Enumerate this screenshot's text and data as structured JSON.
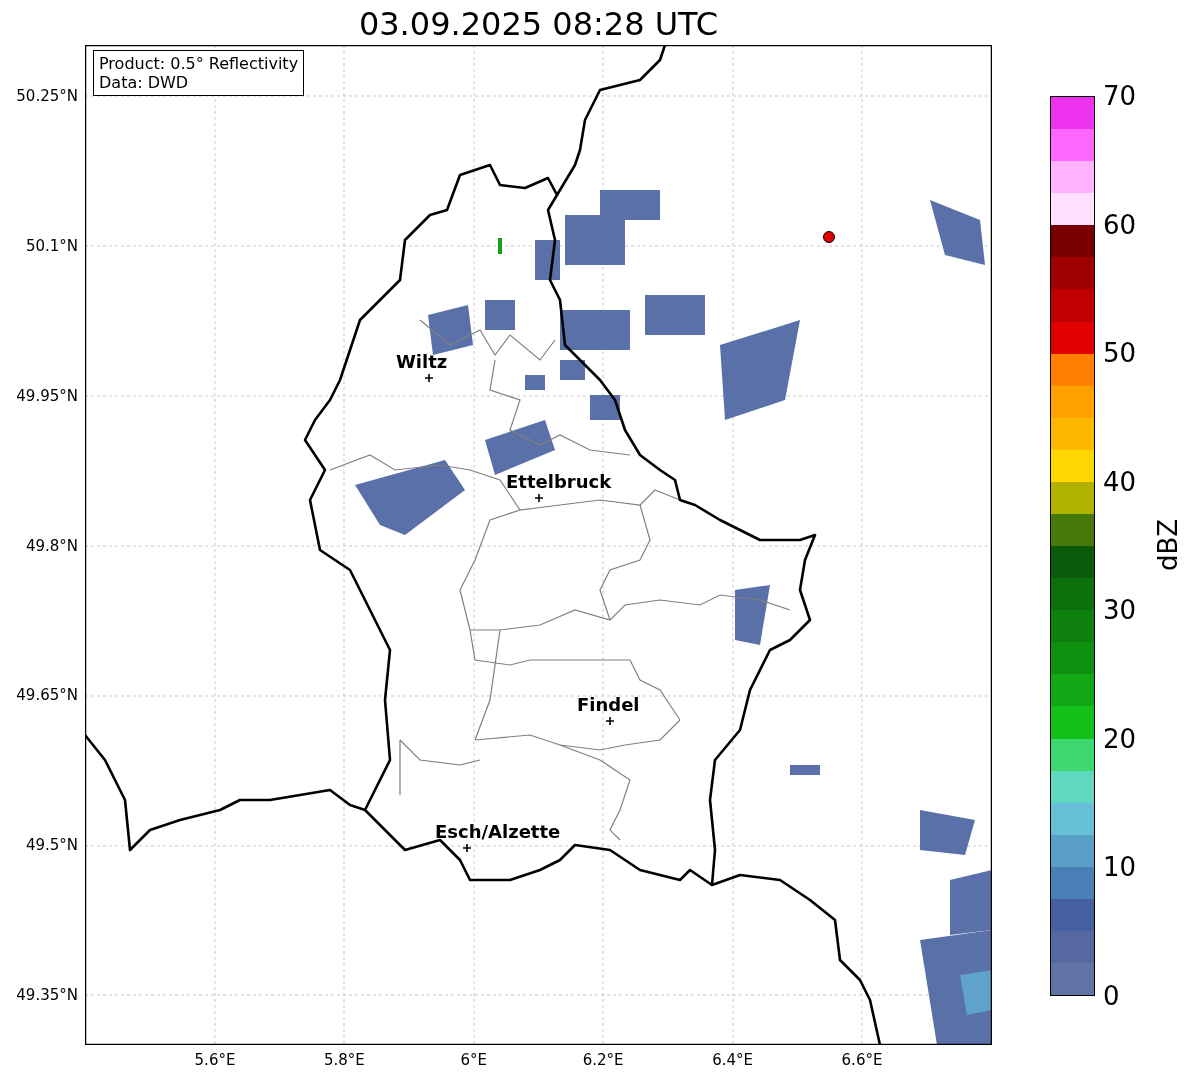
{
  "title": "03.09.2025 08:28 UTC",
  "info_box": [
    "Product: 0.5° Reflectivity",
    "Data: DWD"
  ],
  "map": {
    "cities": [
      {
        "name": "Wiltz"
      },
      {
        "name": "Ettelbruck"
      },
      {
        "name": "Findel"
      },
      {
        "name": "Esch/Alzette"
      }
    ],
    "xticks": [
      "5.6°E",
      "5.8°E",
      "6°E",
      "6.2°E",
      "6.4°E",
      "6.6°E"
    ],
    "yticks": [
      "50.25°N",
      "50.1°N",
      "49.95°N",
      "49.8°N",
      "49.65°N",
      "49.5°N",
      "49.35°N"
    ]
  },
  "colorbar": {
    "label": "dBZ",
    "ticks": [
      "70",
      "60",
      "50",
      "40",
      "30",
      "20",
      "10",
      "0"
    ],
    "bins": [
      {
        "color": "#ee33ee"
      },
      {
        "color": "#ff66ff"
      },
      {
        "color": "#ffb3ff"
      },
      {
        "color": "#ffe0ff"
      },
      {
        "color": "#780000"
      },
      {
        "color": "#a00000"
      },
      {
        "color": "#c00000"
      },
      {
        "color": "#e00000"
      },
      {
        "color": "#ff8000"
      },
      {
        "color": "#ff9f00"
      },
      {
        "color": "#ffb800"
      },
      {
        "color": "#ffd700"
      },
      {
        "color": "#b2b200"
      },
      {
        "color": "#457a0a"
      },
      {
        "color": "#0a5a0a"
      },
      {
        "color": "#0c700c"
      },
      {
        "color": "#0e800e"
      },
      {
        "color": "#10900f"
      },
      {
        "color": "#10a814"
      },
      {
        "color": "#12c018"
      },
      {
        "color": "#3dd670"
      },
      {
        "color": "#60d8c0"
      },
      {
        "color": "#65c0d8"
      },
      {
        "color": "#5a9fc8"
      },
      {
        "color": "#4a7fb5"
      },
      {
        "color": "#4460a0"
      },
      {
        "color": "#5568a0"
      },
      {
        "color": "#6373a5"
      }
    ]
  }
}
